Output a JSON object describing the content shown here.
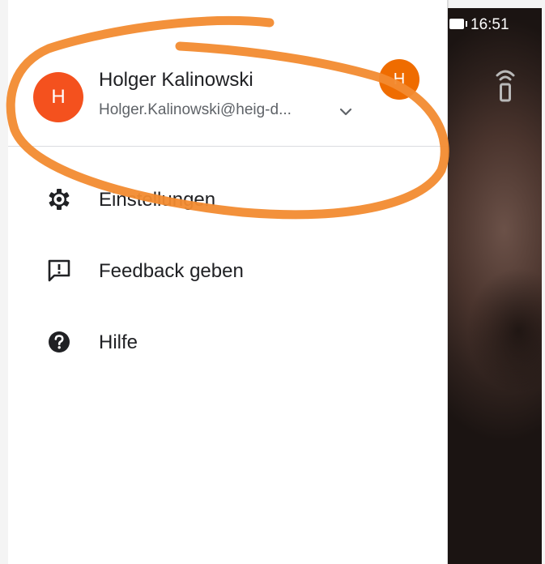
{
  "status_bar": {
    "time": "16:51"
  },
  "account": {
    "avatar_letter": "H",
    "secondary_avatar_letter": "H",
    "name": "Holger Kalinowski",
    "email": "Holger.Kalinowski@heig-d...",
    "icons": {
      "toggle": "chevron-down-icon"
    },
    "colors": {
      "avatar": "#f4511e",
      "secondary_avatar": "#ef6c00"
    }
  },
  "menu": {
    "items": [
      {
        "label": "Einstellungen",
        "icon": "gear-icon"
      },
      {
        "label": "Feedback geben",
        "icon": "feedback-icon"
      },
      {
        "label": "Hilfe",
        "icon": "help-icon"
      }
    ]
  },
  "annotation": {
    "color": "#f28b30",
    "shape": "hand-drawn ellipse around account header"
  },
  "icons": {
    "cast": "cast-icon",
    "battery": "battery-icon"
  }
}
